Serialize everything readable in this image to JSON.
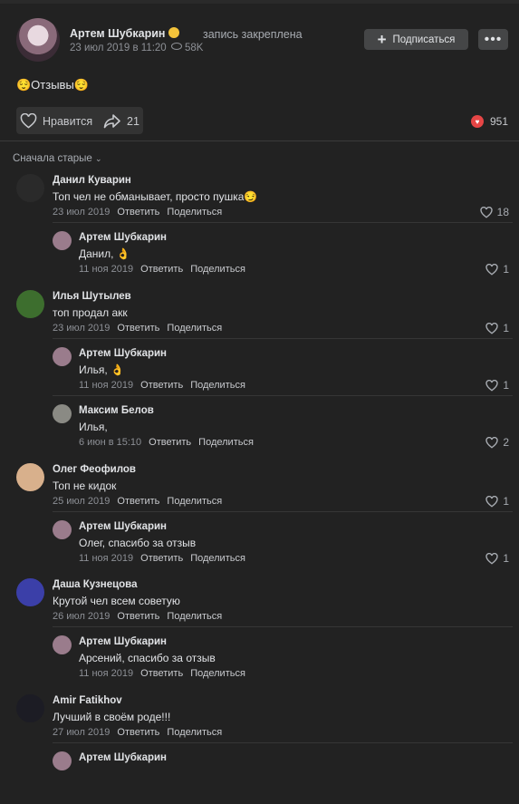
{
  "post": {
    "author": "Артем Шубкарин",
    "pinned_label": "запись закреплена",
    "date": "23 июл 2019 в 11:20",
    "views": "58K",
    "subscribe_label": "Подписаться",
    "more_label": "•••",
    "text": "😌Отзывы😌",
    "like_label": "Нравится",
    "shares": "21",
    "reactions_count": "951"
  },
  "comments_sort": "Сначала старые",
  "actions": {
    "reply": "Ответить",
    "share": "Поделиться"
  },
  "comments": [
    {
      "name": "Данил Куварин",
      "text": "Топ чел не обманывает, просто пушка😏",
      "date": "23 июл 2019",
      "likes": "18",
      "avatar_color": "#2a2a2a"
    },
    {
      "name": "Артем Шубкарин",
      "text": "Данил, 👌",
      "date": "11 ноя 2019",
      "likes": "1",
      "avatar_color": "#9a7c8c"
    },
    {
      "name": "Илья Шутылев",
      "text": "топ продал акк",
      "date": "23 июл 2019",
      "likes": "1",
      "avatar_color": "#3d6e2e"
    },
    {
      "name": "Артем Шубкарин",
      "text": "Илья, 👌",
      "date": "11 ноя 2019",
      "likes": "1",
      "avatar_color": "#9a7c8c"
    },
    {
      "name": "Максим Белов",
      "text": "Илья,",
      "date": "6 июн в 15:10",
      "likes": "2",
      "avatar_color": "#8a8a84"
    },
    {
      "name": "Олег Феофилов",
      "text": "Топ не кидок",
      "date": "25 июл 2019",
      "likes": "1",
      "avatar_color": "#d8b08c"
    },
    {
      "name": "Артем Шубкарин",
      "text": "Олег, спасибо за отзыв",
      "date": "11 ноя 2019",
      "likes": "1",
      "avatar_color": "#9a7c8c"
    },
    {
      "name": "Даша Кузнецова",
      "text": "Крутой чел всем советую",
      "date": "26 июл 2019",
      "likes": "",
      "avatar_color": "#3b3fa8"
    },
    {
      "name": "Артем Шубкарин",
      "text": "Арсений, спасибо за отзыв",
      "date": "11 ноя 2019",
      "likes": "",
      "avatar_color": "#9a7c8c"
    },
    {
      "name": "Amir Fatikhov",
      "text": "Лучший в своём роде!!!",
      "date": "27 июл 2019",
      "likes": "",
      "avatar_color": "#1c1c24"
    },
    {
      "name": "Артем Шубкарин",
      "text": "",
      "date": "",
      "likes": "",
      "avatar_color": "#9a7c8c"
    }
  ],
  "colors": {
    "background": "#222222",
    "button": "#454647",
    "reaction": "#e64646"
  }
}
